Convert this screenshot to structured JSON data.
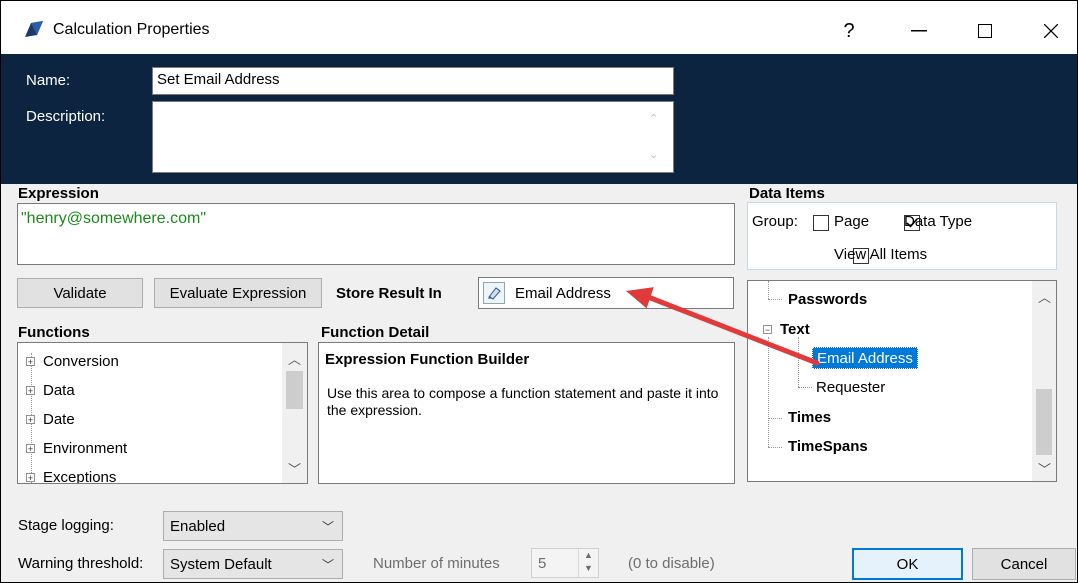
{
  "window": {
    "title": "Calculation Properties",
    "help": "?",
    "minimize": "—",
    "maximize": "☐",
    "close": "✕"
  },
  "header": {
    "name_label": "Name:",
    "name_value": "Set Email Address",
    "description_label": "Description:",
    "description_value": ""
  },
  "expression": {
    "label": "Expression",
    "value": "\"henry@somewhere.com\""
  },
  "buttons": {
    "validate": "Validate",
    "evaluate": "Evaluate Expression"
  },
  "store_result": {
    "label": "Store Result In",
    "value": "Email Address"
  },
  "data_items": {
    "label": "Data Items",
    "group_label": "Group:",
    "page_label": "Page",
    "page_checked": false,
    "data_type_label": "Data Type",
    "data_type_checked": true,
    "view_all_label": "View All Items",
    "view_all_checked": false,
    "tree": [
      "Passwords",
      "Text",
      "Email Address",
      "Requester",
      "Times",
      "TimeSpans"
    ]
  },
  "functions": {
    "label": "Functions",
    "items": [
      "Conversion",
      "Data",
      "Date",
      "Environment",
      "Exceptions"
    ]
  },
  "function_detail": {
    "label": "Function Detail",
    "title": "Expression Function Builder",
    "text": "Use this area to compose a function statement and paste it into the expression."
  },
  "stage_logging": {
    "label": "Stage logging:",
    "value": "Enabled"
  },
  "warning_threshold": {
    "label": "Warning threshold:",
    "value": "System Default",
    "minutes_label": "Number of minutes",
    "minutes_value": "5",
    "hint": "(0 to disable)"
  },
  "footer": {
    "ok": "OK",
    "cancel": "Cancel"
  },
  "colors": {
    "header_bg": "#0c2440",
    "expression_text": "#1a8a1a",
    "selection": "#0078d7",
    "arrow": "#e03a3a"
  }
}
